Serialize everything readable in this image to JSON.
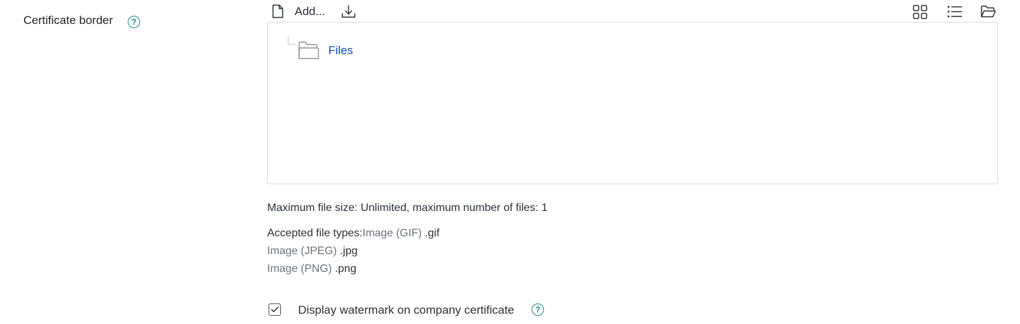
{
  "field": {
    "label": "Certificate border",
    "help_glyph": "?"
  },
  "toolbar": {
    "add_label": "Add..."
  },
  "icons": {
    "add": "file-icon",
    "download": "download-icon",
    "view_icons": "grid-icon",
    "view_list": "list-icon",
    "view_tree": "folder-open-icon",
    "folder": "folder-icon"
  },
  "tree": {
    "root_folder": "Files"
  },
  "limits": {
    "text": "Maximum file size: Unlimited, maximum number of files: 1"
  },
  "accepted": {
    "label": "Accepted file types:",
    "types": [
      {
        "name": "Image (GIF)",
        "ext": ".gif"
      },
      {
        "name": "Image (JPEG)",
        "ext": ".jpg"
      },
      {
        "name": "Image (PNG)",
        "ext": ".png"
      }
    ]
  },
  "watermark": {
    "label": "Display watermark on company certificate",
    "checked": true
  },
  "colors": {
    "link": "#0f47ad",
    "help": "#1d8a8a",
    "border": "#d7d9dc",
    "muted": "#6a737b"
  }
}
